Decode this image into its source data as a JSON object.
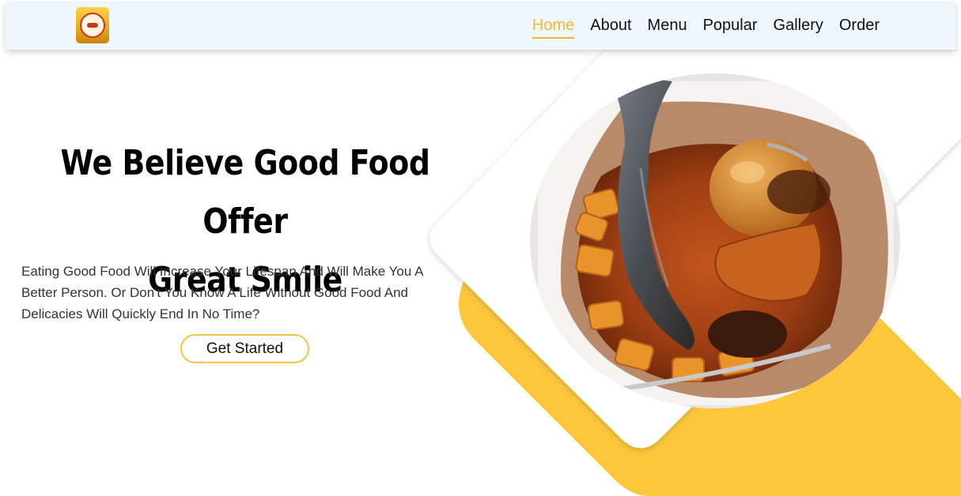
{
  "header": {
    "logo_icon": "restaurant-logo",
    "nav": [
      {
        "label": "Home",
        "active": true
      },
      {
        "label": "About",
        "active": false
      },
      {
        "label": "Menu",
        "active": false
      },
      {
        "label": "Popular",
        "active": false
      },
      {
        "label": "Gallery",
        "active": false
      },
      {
        "label": "Order",
        "active": false
      }
    ]
  },
  "hero": {
    "title_line1": "We Believe Good Food Offer",
    "title_line2": "Great Smile",
    "description": "Eating Good Food Will Increase Your Lifespan And Will Make You A Better Person. Or Don't You Know A Life Without Good Food And Delicacies Will Quickly End In No Time?",
    "cta_label": "Get Started",
    "image_icon": "food-plate-image"
  },
  "colors": {
    "accent": "#f5b731",
    "header_bg": "#eef7fd",
    "yellow_shape": "#fcc73a"
  }
}
